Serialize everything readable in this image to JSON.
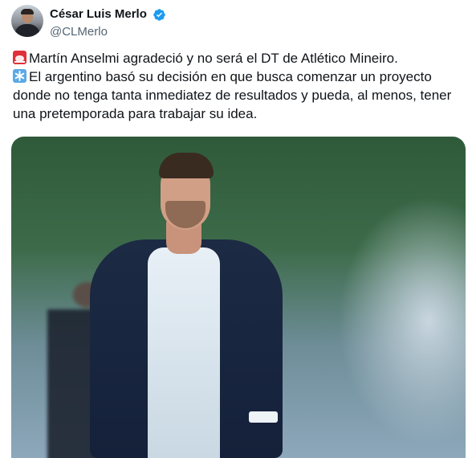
{
  "author": {
    "display_name": "César Luis Merlo",
    "handle": "@CLMerlo",
    "verified": true,
    "verified_color": "#1d9bf0"
  },
  "tweet": {
    "lines": [
      "Martín Anselmi agradeció y no será el DT de Atlético Mineiro.",
      "El argentino basó su decisión en que busca comenzar un proyecto",
      "donde no tenga tanta inmediatez de resultados y pueda, al menos, tener",
      "una pretemporada para trabajar su idea."
    ],
    "emojis": [
      "rotating-light-icon",
      "asterisk-icon"
    ]
  },
  "photo": {
    "alt_subject": "coach-photo"
  },
  "colors": {
    "text": "#0f1419",
    "muted": "#536471"
  }
}
